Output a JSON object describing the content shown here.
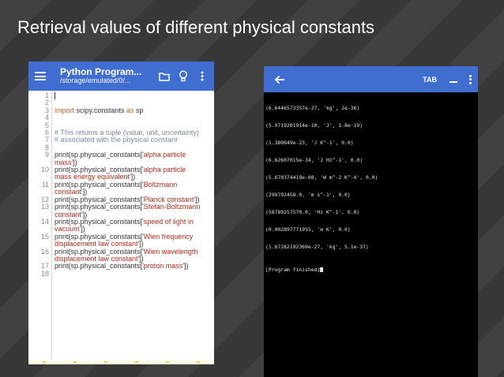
{
  "slide": {
    "title": "Retrieval values of different physical constants"
  },
  "editor": {
    "title": "Python Program...",
    "path": "/storage/emulated/0/...",
    "line_numbers": [
      "1",
      "2",
      "3",
      "4",
      "5",
      "6",
      "7",
      "8",
      "9",
      "",
      "10",
      "",
      "11",
      "",
      "12",
      "13",
      "",
      "14",
      "",
      "15",
      "",
      "16",
      "",
      "17",
      "18"
    ],
    "code": {
      "l3": {
        "kw": "import",
        "rest": " scipy.constants ",
        "kw2": "as",
        "rest2": " sp"
      },
      "l6": "# This returns a tuple (value, unit, uncertainty)",
      "l7": "# associated with the physical constant",
      "prefix": "print(sp.physical_constants['",
      "l9a": "alpha particle",
      "l9b": "mass",
      "l10a": "alpha particle",
      "l10b": "mass energy equivalent",
      "l11a": "Boltzmann",
      "l11b": "constant",
      "l12": "Planck constant",
      "l13a": "Stefan-Boltzmann",
      "l13b": "constant",
      "l14a": "speed of light in",
      "l14b": "vacuum",
      "l15a": "Wien frequency",
      "l15b": "displacement law constant",
      "l16a": "Wien wavelength",
      "l16b": "displacement law constant",
      "l17": "proton mass",
      "suffix_open": "",
      "suffix": "'])"
    }
  },
  "terminal": {
    "tab_label": "TAB",
    "output": [
      "(6.6446573357e-27, 'kg', 2e-36)",
      "(5.9719201914e-10, 'J', 1.8e-19)",
      "(1.380649e-23, 'J K^-1', 0.0)",
      "(6.62607015e-34, 'J Hz^-1', 0.0)",
      "(5.670374419e-08, 'W m^-2 K^-4', 0.0)",
      "(299792458.0, 'm s^-1', 0.0)",
      "(58789257570.0, 'Hz K^-1', 0.0)",
      "(0.002897771955, 'm K', 0.0)",
      "(1.67262192369e-27, 'kg', 5.1e-37)"
    ],
    "finished": "[Program finished]"
  }
}
